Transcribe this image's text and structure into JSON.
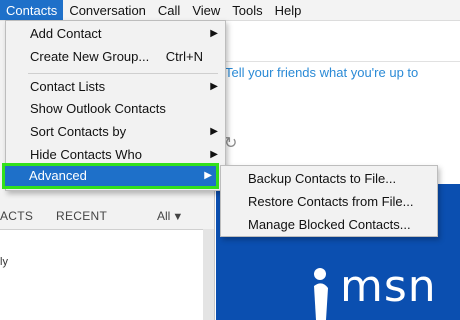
{
  "menubar": {
    "items": [
      "Contacts",
      "Conversation",
      "Call",
      "View",
      "Tools",
      "Help"
    ]
  },
  "contacts_menu": {
    "items": [
      {
        "label": "Add Contact",
        "shortcut": "",
        "submenu": true
      },
      {
        "label": "Create New Group...",
        "shortcut": "Ctrl+N",
        "submenu": false
      },
      {
        "label": "Contact Lists",
        "shortcut": "",
        "submenu": true
      },
      {
        "label": "Show Outlook Contacts",
        "shortcut": "",
        "submenu": false
      },
      {
        "label": "Sort Contacts by",
        "shortcut": "",
        "submenu": true
      },
      {
        "label": "Hide Contacts Who",
        "shortcut": "",
        "submenu": true
      },
      {
        "label": "Advanced",
        "shortcut": "",
        "submenu": true,
        "highlighted": true
      }
    ]
  },
  "advanced_submenu": {
    "items": [
      "Backup Contacts to File...",
      "Restore Contacts from File...",
      "Manage Blocked Contacts..."
    ]
  },
  "left_pane": {
    "tab_contacts": "ACTS",
    "tab_recent": "RECENT",
    "filter_label": "All",
    "list_row": "ly"
  },
  "right_pane": {
    "status_placeholder": "Tell your friends what you're up to",
    "brand_text": "msn"
  },
  "colors": {
    "menu_highlight": "#1e70c9",
    "outline": "#33e11b",
    "status_text": "#2a8ad6",
    "brand_panel": "#0b4fb0"
  }
}
